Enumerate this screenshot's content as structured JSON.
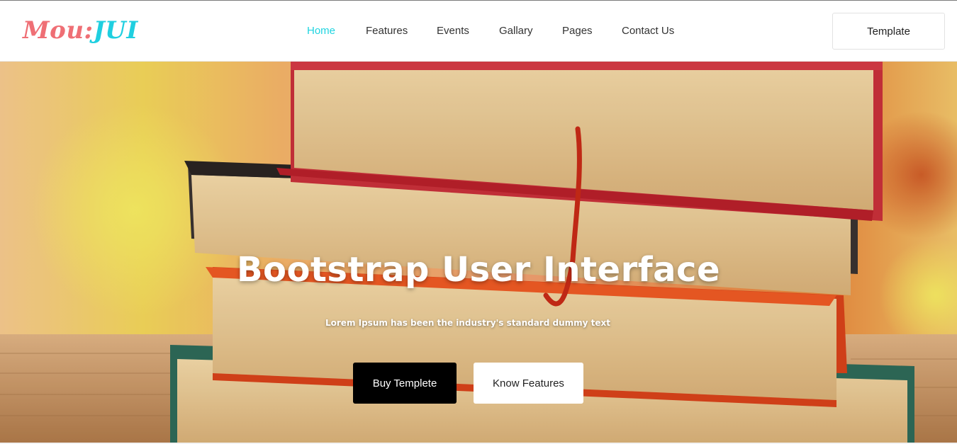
{
  "brand": {
    "logo_part1": "Mou:",
    "logo_part2": "JUI",
    "color_pink": "#ef6f75",
    "color_cyan": "#1fcfe0"
  },
  "nav": {
    "items": [
      {
        "label": "Home",
        "active": true
      },
      {
        "label": "Features"
      },
      {
        "label": "Events"
      },
      {
        "label": "Gallary"
      },
      {
        "label": "Pages"
      },
      {
        "label": "Contact Us"
      }
    ],
    "active_color": "#1fd4e0"
  },
  "header": {
    "template_button": "Template"
  },
  "hero": {
    "title": "Bootstrap User Interface",
    "subtitle": "Lorem Ipsum has been the industry's standard dummy text",
    "buy_button": "Buy Templete",
    "know_button": "Know Features",
    "background": "stack-of-books-photo"
  }
}
